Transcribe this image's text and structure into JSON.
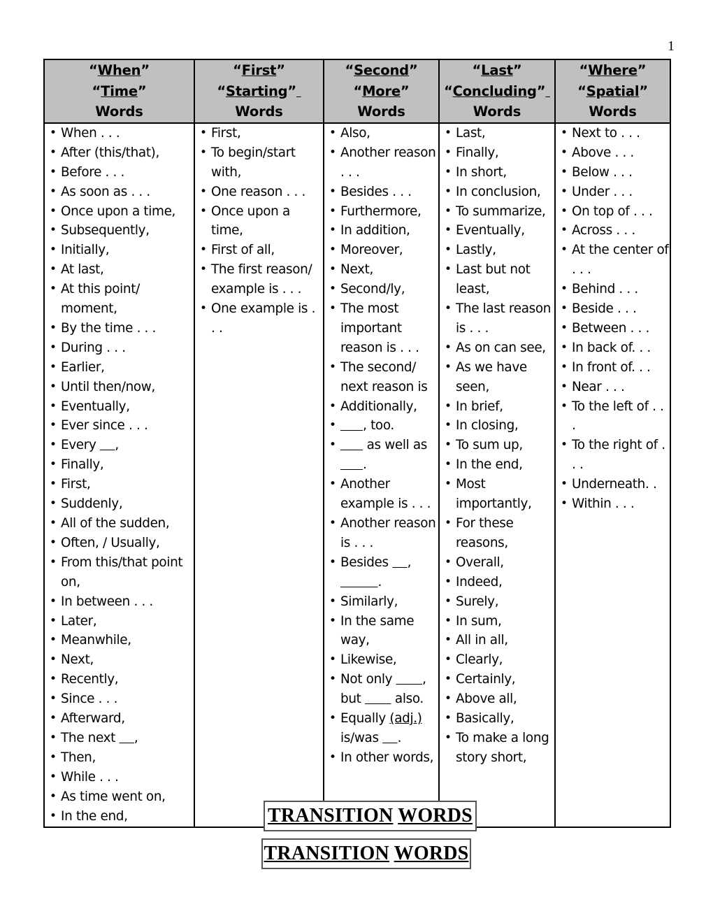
{
  "page": {
    "number": "1"
  },
  "table": {
    "columns": [
      {
        "header": {
          "line1_quoted": "“When”",
          "line2_quoted": "“Time”",
          "line3": "Words"
        },
        "items": [
          "When . . .",
          "After (this/that),",
          "Before . . .",
          "As soon as . . .",
          "Once upon a time,",
          "Subsequently,",
          "Initially,",
          "At last,",
          "At this point/ moment,",
          "By the time . . .",
          "During . . .",
          "Earlier,",
          "Until then/now,",
          "Eventually,",
          "Ever since . . .",
          "Every ____,",
          "Finally,",
          "First,",
          "Suddenly,",
          "All of the sudden,",
          "Often, / Usually,",
          "From this/that point on,",
          "In between . . .",
          "Later,",
          "Meanwhile,",
          "Next,",
          "Recently,",
          "Since . . .",
          "Afterward,",
          "The next ____,",
          "Then,",
          "While . . .",
          "As time went on,",
          "In the end,"
        ]
      },
      {
        "header": {
          "line1_quoted": "“First”",
          "line2_quoted": "“Starting”_",
          "line3": "Words"
        },
        "items": [
          "First,",
          "To begin/start with,",
          "One reason . . .",
          "Once upon a time,",
          "First of all,",
          "The first reason/ example is . . .",
          "One example is . . ."
        ]
      },
      {
        "header": {
          "line1_quoted": "“Second”",
          "line2_quoted": "“More”",
          "line3": "Words"
        },
        "items": [
          "Also,",
          "Another reason . . .",
          "Besides . . .",
          "Furthermore,",
          "In addition,",
          "Moreover,",
          "Next,",
          "Second/ly,",
          "The most important reason is . . .",
          "The second/ next reason is",
          "Additionally,",
          "______, too.",
          "______ as well as ______.",
          "Another example is . . .",
          "Another reason is . . .",
          "Besides ____, __________.",
          "Similarly,",
          "In the same way,",
          "Likewise,",
          "Not only _______, but _______ also.",
          "Equally (adj.) is/was ____.",
          "In other words,"
        ]
      },
      {
        "header": {
          "line1_quoted": "“Last”",
          "line2_quoted": "“Concluding”_",
          "line3": "Words"
        },
        "items": [
          "Last,",
          "Finally,",
          "In short,",
          "In conclusion,",
          "To summarize,",
          "Eventually,",
          "Lastly,",
          "Last but  not least,",
          "The last reason is . . .",
          "As on can see,",
          "As we have seen,",
          "In brief,",
          "In closing,",
          "To sum up,",
          "In the end,",
          "Most importantly,",
          "For these reasons,",
          "Overall,",
          "Indeed,",
          "Surely,",
          "In sum,",
          "All in all,",
          "Clearly,",
          "Certainly,",
          "Above all,",
          "Basically,",
          "To make a long story short,"
        ]
      },
      {
        "header": {
          "line1_quoted": "“Where”",
          "line2_quoted": "“Spatial”",
          "line3": "Words"
        },
        "items": [
          "Next to . . .",
          "Above . . .",
          "Below . . .",
          "Under . . .",
          "On top of . . .",
          "Across . . .",
          "At the center of . . .",
          "Behind . . .",
          "Beside . . .",
          "Between . . .",
          "In back of. . .",
          "In front of. . .",
          "Near . . .",
          "To the left of . . .",
          "To the right of . . .",
          "Underneath. .",
          "Within . . ."
        ]
      }
    ]
  },
  "overlay_boxes": {
    "upper": {
      "word1": "TRANSITION",
      "word2": "WORDS"
    },
    "lower": {
      "word1": "TRANSITION",
      "word2": "WORDS"
    }
  },
  "colors": {
    "header_background": "#c0c0c0",
    "border": "#000000",
    "text": "#000000",
    "page_background": "#ffffff"
  }
}
